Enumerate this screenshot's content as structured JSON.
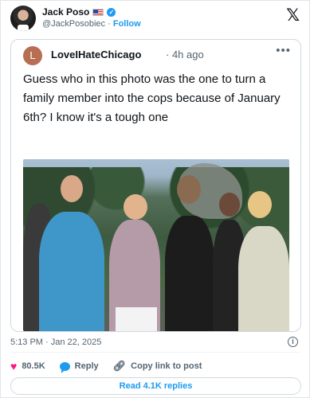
{
  "author": {
    "name": "Jack Poso",
    "handle": "@JackPosobiec",
    "follow_label": "Follow",
    "icons": [
      "us-flag-icon",
      "verified-badge-icon"
    ]
  },
  "brand": {
    "logo": "𝕏"
  },
  "quoted": {
    "avatar_letter": "L",
    "name": "LoveIHateChicago",
    "time": "· 4h ago",
    "more": "•••",
    "text": "Guess who in this photo was the one to turn a family member into the cops because of January 6th? I know it's a tough one"
  },
  "meta": {
    "timestamp": "5:13 PM · Jan 22, 2025",
    "info": "i"
  },
  "actions": {
    "likes": "80.5K",
    "reply_label": "Reply",
    "copy_link_label": "Copy link to post"
  },
  "read_replies_label": "Read 4.1K replies",
  "colors": {
    "accent": "#1d9bf0",
    "like": "#f91880",
    "secondary": "#536471"
  }
}
